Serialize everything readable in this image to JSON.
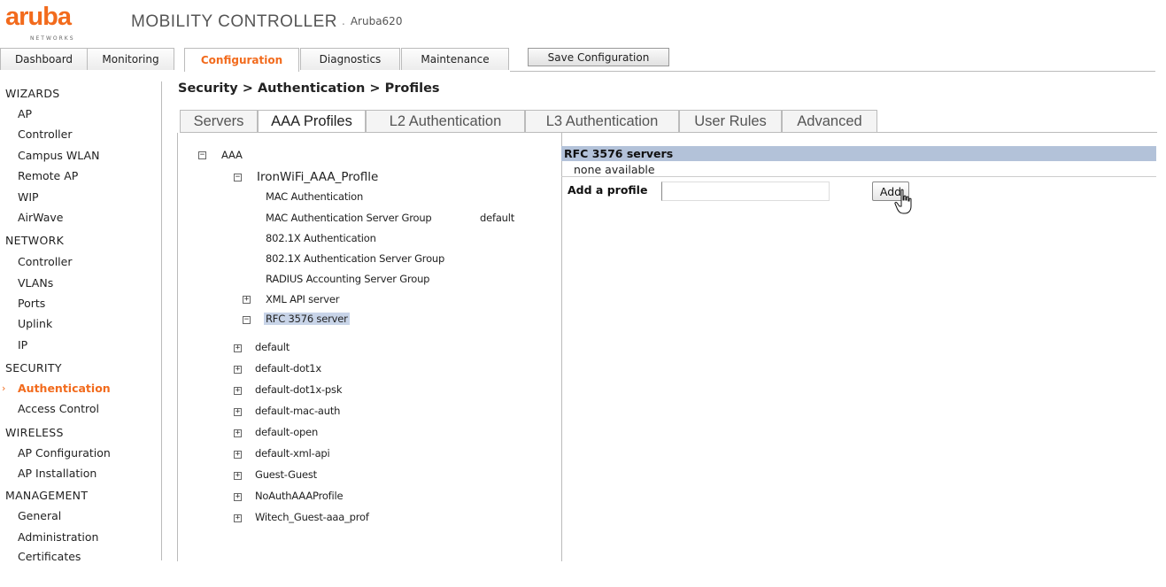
{
  "header": {
    "logo_text": "aruba",
    "logo_subtext": "NETWORKS",
    "app_title": "MOBILITY CONTROLLER",
    "device_name": "Aruba620"
  },
  "main_tabs": [
    {
      "label": "Dashboard"
    },
    {
      "label": "Monitoring"
    },
    {
      "label": "Configuration"
    },
    {
      "label": "Diagnostics"
    },
    {
      "label": "Maintenance"
    }
  ],
  "save_configuration_label": "Save Configuration",
  "sidebar": {
    "sections": [
      {
        "title": "WIZARDS",
        "items": [
          "AP",
          "Controller",
          "Campus WLAN",
          "Remote AP",
          "WIP",
          "AirWave"
        ]
      },
      {
        "title": "NETWORK",
        "items": [
          "Controller",
          "VLANs",
          "Ports",
          "Uplink",
          "IP"
        ]
      },
      {
        "title": "SECURITY",
        "items": [
          "Authentication",
          "Access Control"
        ]
      },
      {
        "title": "WIRELESS",
        "items": [
          "AP Configuration",
          "AP Installation"
        ]
      },
      {
        "title": "MANAGEMENT",
        "items": [
          "General",
          "Administration",
          "Certificates"
        ]
      }
    ],
    "active_item": "Authentication"
  },
  "breadcrumb": "Security > Authentication > Profiles",
  "sub_tabs": [
    {
      "label": "Servers"
    },
    {
      "label": "AAA Profiles"
    },
    {
      "label": "L2 Authentication"
    },
    {
      "label": "L3 Authentication"
    },
    {
      "label": "User Rules"
    },
    {
      "label": "Advanced"
    }
  ],
  "tree": {
    "root": "AAA",
    "expanded_profile": "IronWiFi_AAA_Proflle",
    "profile_children": [
      {
        "label": "MAC Authentication",
        "value": ""
      },
      {
        "label": "MAC Authentication Server Group",
        "value": "default"
      },
      {
        "label": "802.1X Authentication",
        "value": ""
      },
      {
        "label": "802.1X Authentication Server Group",
        "value": ""
      },
      {
        "label": "RADIUS Accounting Server Group",
        "value": ""
      }
    ],
    "xml_api_server": "XML API server",
    "rfc_server": "RFC 3576 server",
    "other_profiles": [
      "default",
      "default-dot1x",
      "default-dot1x-psk",
      "default-mac-auth",
      "default-open",
      "default-xml-api",
      "Guest-Guest",
      "NoAuthAAAProfile",
      "Witech_Guest-aaa_prof"
    ],
    "toggle_expand": "+",
    "toggle_collapse": "−"
  },
  "detail": {
    "header": "RFC 3576 servers",
    "none_text": "none available",
    "add_profile_label": "Add a profile",
    "add_input_value": "",
    "add_button_label": "Add"
  },
  "colors": {
    "brand_orange": "#f26b1d",
    "header_blue": "#b3c2d9",
    "selected_node": "#c8d4e8"
  }
}
